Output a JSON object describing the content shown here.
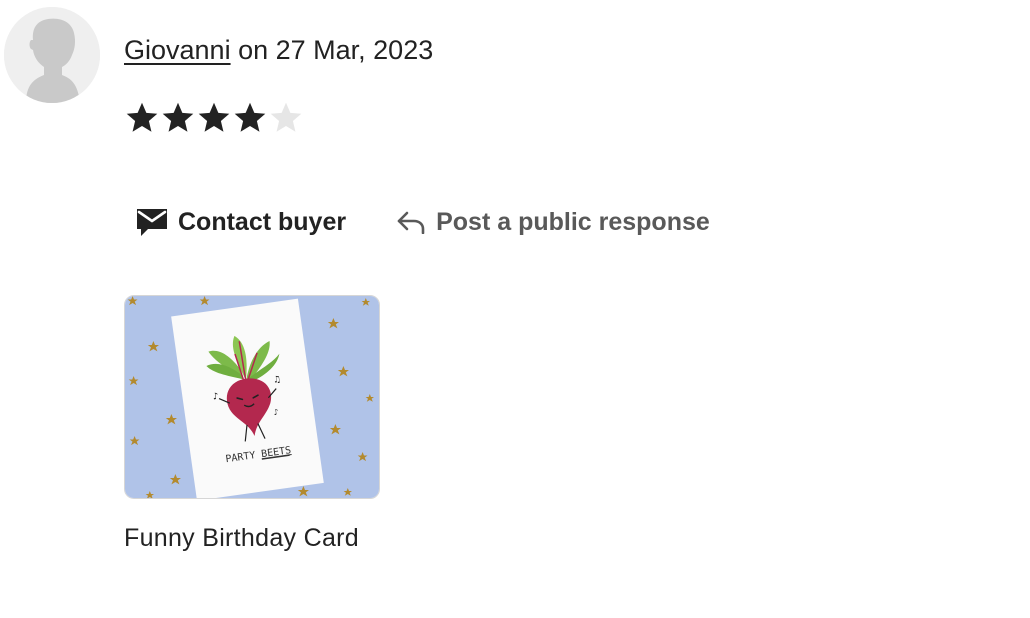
{
  "review": {
    "reviewer_name": "Giovanni",
    "date_prefix": " on ",
    "date": "27 Mar, 2023",
    "rating": 4,
    "rating_max": 5
  },
  "actions": {
    "contact_label": "Contact buyer",
    "contact_icon": "envelope-chat-icon",
    "response_label": "Post a public response",
    "response_icon": "reply-arrow-icon"
  },
  "product": {
    "title": "Funny Birthday Card",
    "image_text_1": "PARTY",
    "image_text_2": "BEETS"
  },
  "colors": {
    "star_filled": "#222222",
    "star_empty": "#e6e6e6",
    "text_primary": "#222222",
    "text_secondary": "#595959",
    "thumb_background": "#b0c3e8",
    "beet": "#b3284e",
    "leaves": "#7dba4a"
  }
}
